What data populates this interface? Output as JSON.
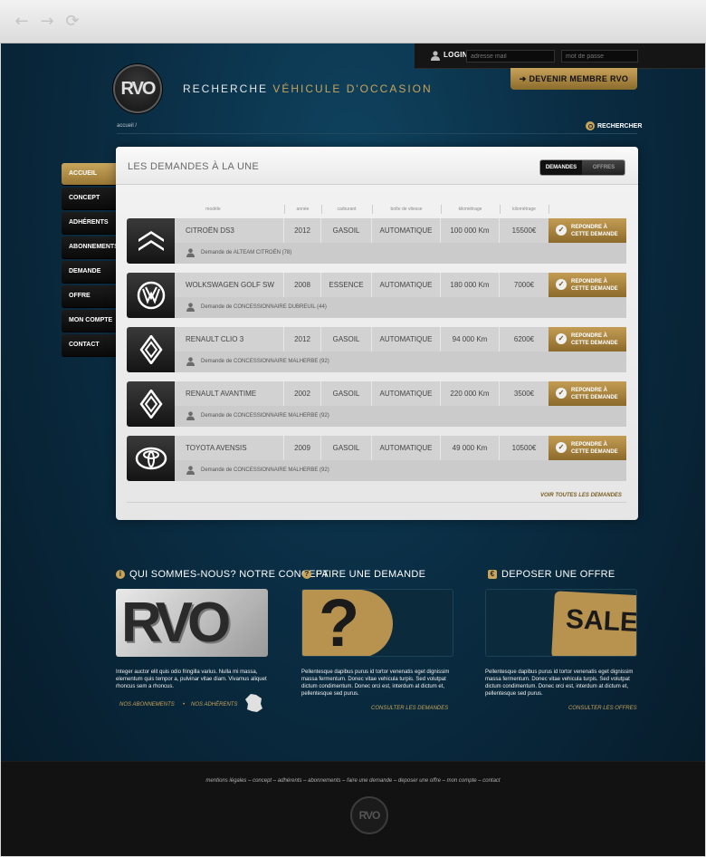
{
  "browser": {
    "back": "←",
    "forward": "→",
    "reload": "⟳"
  },
  "header": {
    "login_label": "LOGIN",
    "email_placeholder": "adresse mail",
    "password_placeholder": "mot de passe",
    "logo_text": "RVO",
    "tagline_a": "RECHERCHE",
    "tagline_b": "VÉHICULE D'OCCASION",
    "join_label": "DEVENIR MEMBRE RVO",
    "join_arrow": "➔"
  },
  "breadcrumb": "accueil /",
  "search_label": "RECHERCHER",
  "sidebar": {
    "items": [
      {
        "label": "ACCUEIL"
      },
      {
        "label": "CONCEPT"
      },
      {
        "label": "ADHÉRENTS"
      },
      {
        "label": "ABONNEMENTS"
      },
      {
        "label": "DEMANDE"
      },
      {
        "label": "OFFRE"
      },
      {
        "label": "MON COMPTE"
      },
      {
        "label": "CONTACT"
      }
    ]
  },
  "panel": {
    "title": "LES DEMANDES À LA UNE",
    "tab_requests": "DEMANDES",
    "tab_offers": "OFFRES",
    "columns": {
      "model": "modèle",
      "year": "année",
      "fuel": "carburant",
      "gearbox": "boîte de vitesse",
      "mileage": "kilométrage",
      "price": "kilométrage"
    },
    "reply_l1": "REPONDRE À",
    "reply_l2": "CETTE DEMANDE",
    "reply_check": "✓",
    "see_all": "VOIR TOUTES LES DEMANDES",
    "rows": [
      {
        "brand_icon": "citroen-icon",
        "model": "CITROËN DS3",
        "year": "2012",
        "fuel": "GASOIL",
        "gearbox": "AUTOMATIQUE",
        "km": "100 000 Km",
        "price": "15500€",
        "requester": "Demande de ALTEAM CITROËN (78)"
      },
      {
        "brand_icon": "volkswagen-icon",
        "model": "WOLKSWAGEN GOLF SW",
        "year": "2008",
        "fuel": "ESSENCE",
        "gearbox": "AUTOMATIQUE",
        "km": "180 000 Km",
        "price": "7000€",
        "requester": "Demande de CONCESSIONNAIRE DUBREUIL (44)"
      },
      {
        "brand_icon": "renault-icon",
        "model": "RENAULT CLIO 3",
        "year": "2012",
        "fuel": "GASOIL",
        "gearbox": "AUTOMATIQUE",
        "km": "94 000 Km",
        "price": "6200€",
        "requester": "Demande de CONCESSIONNAIRE MALHERBE (92)"
      },
      {
        "brand_icon": "renault-icon",
        "model": "RENAULT AVANTIME",
        "year": "2002",
        "fuel": "GASOIL",
        "gearbox": "AUTOMATIQUE",
        "km": "220 000 Km",
        "price": "3500€",
        "requester": "Demande de CONCESSIONNAIRE MALHERBE (92)"
      },
      {
        "brand_icon": "toyota-icon",
        "model": "TOYOTA AVENSIS",
        "year": "2009",
        "fuel": "GASOIL",
        "gearbox": "AUTOMATIQUE",
        "km": "49 000 Km",
        "price": "10500€",
        "requester": "Demande de CONCESSIONNAIRE MALHERBE (92)"
      }
    ]
  },
  "sections": {
    "concept": {
      "icon": "i",
      "title": "QUI SOMMES-NOUS? NOTRE CONCEPT",
      "image_text": "RVO",
      "text": "Integer auctor elit quis odio fringilla varius. Nulla mi massa, elementum quis tempor a, pulvinar vitae diam. Vivamus aliquet rhoncus sem a rhoncus.",
      "link1": "NOS ABONNEMENTS",
      "link_sep": "•",
      "link2": "NOS ADHÉRENTS"
    },
    "request": {
      "icon": "?",
      "title": "FAIRE UNE DEMANDE",
      "image_text": "?",
      "text": "Pellentesque dapibus purus id tortor venenatis eget dignissim massa fermentum. Donec vitae vehicula turpis. Sed volutpat dictum condimentum. Donec orci est, interdum at dictum et, pellentesque sed purus.",
      "link": "CONSULTER LES DEMANDES"
    },
    "offer": {
      "icon": "€",
      "title": "DEPOSER UNE OFFRE",
      "image_text": "SALE",
      "text": "Pellentesque dapibus purus id tortor venenatis eget dignissim massa fermentum. Donec vitae vehicula turpis. Sed volutpat dictum condimentum. Donec orci est, interdum at dictum et, pellentesque sed purus.",
      "link": "CONSULTER LES OFFRES"
    }
  },
  "footer": {
    "links": "mentions légales – concept – adhérents – abonnements – faire une demande – deposer une offre – mon compte – contact",
    "logo_text": "RVO"
  },
  "colors": {
    "gold": "#c8a45a",
    "navy": "#0a2d43",
    "dark": "#121212"
  }
}
